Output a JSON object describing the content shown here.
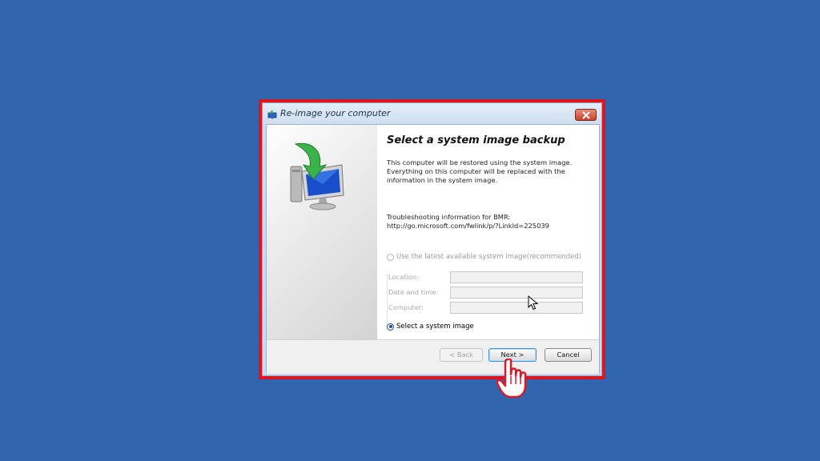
{
  "window": {
    "title": "Re-image your computer",
    "heading": "Select a system image backup",
    "description": "This computer will be restored using the system image. Everything on this computer will be replaced with the information in the system image.",
    "troubleshooting": "Troubleshooting information for BMR:",
    "troubleshooting_link": "http://go.microsoft.com/fwlink/p/?LinkId=225039"
  },
  "options": {
    "latest": {
      "label": "Use the latest available system image(recommended)",
      "checked": false,
      "enabled": false
    },
    "select": {
      "label": "Select a system image",
      "checked": true,
      "enabled": true
    }
  },
  "fields": {
    "location_label": "Location:",
    "location_value": "",
    "datetime_label": "Date and time:",
    "datetime_value": "",
    "computer_label": "Computer:",
    "computer_value": ""
  },
  "buttons": {
    "back": "< Back",
    "next": "Next >",
    "cancel": "Cancel"
  },
  "icons": {
    "title": "restore-icon",
    "close": "close-icon",
    "sidebar": "system-image-restore-icon",
    "pointer": "arrow-cursor-icon",
    "hand": "hand-cursor-icon"
  },
  "colors": {
    "desktop": "#3165ae",
    "highlight": "#e0141f",
    "accent": "#1f4fa0"
  }
}
